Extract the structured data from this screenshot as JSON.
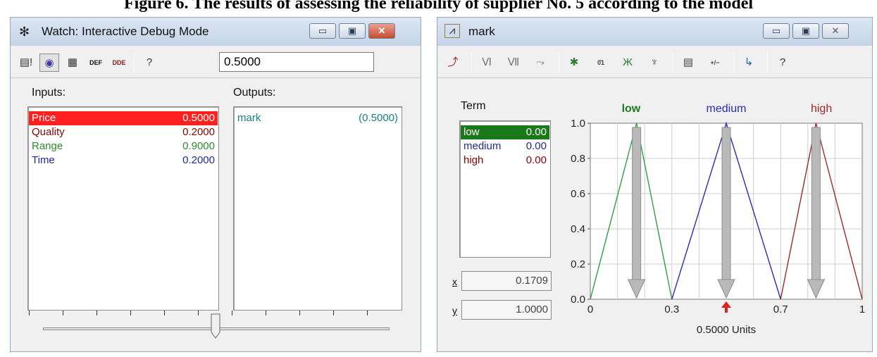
{
  "caption": "Figure 6. The results of assessing the reliability of supplier No. 5 according to the model",
  "watch": {
    "title": "Watch: Interactive Debug Mode",
    "title_icon": "bug-icon",
    "controls": {
      "minimize": "▭",
      "maximize": "▣",
      "close": "✕"
    },
    "toolbar": [
      {
        "id": "watch-mode",
        "glyph": "▤!",
        "icon": "watch-mode-icon",
        "color": "#333333"
      },
      {
        "id": "trace",
        "glyph": "◉",
        "icon": "trace-icon",
        "color": "#3a3aa8",
        "pressed": true
      },
      {
        "id": "clipboard",
        "glyph": "▦",
        "icon": "clipboard-icon",
        "color": "#333333"
      },
      {
        "id": "def",
        "glyph": "DEF",
        "icon": "def-icon",
        "color": "#111111"
      },
      {
        "id": "dde",
        "glyph": "DDE",
        "icon": "dde-icon",
        "color": "#8b1a1a"
      },
      {
        "id": "help",
        "glyph": "?",
        "icon": "help-icon",
        "color": "#333333"
      }
    ],
    "value": "0.5000",
    "inputs_label": "Inputs:",
    "outputs_label": "Outputs:",
    "inputs": [
      {
        "name": "Price",
        "value": "0.5000",
        "color": "#ffffff",
        "bg": "#ff2020",
        "selected": true
      },
      {
        "name": "Quality",
        "value": "0.2000",
        "color": "#8b0000",
        "bg": ""
      },
      {
        "name": "Range",
        "value": "0.9000",
        "color": "#2e8b2e",
        "bg": ""
      },
      {
        "name": "Time",
        "value": "0.2000",
        "color": "#1e2a9a",
        "bg": ""
      }
    ],
    "outputs": [
      {
        "name": "mark",
        "value": "(0.5000)",
        "color": "#1a8080"
      }
    ],
    "slider": {
      "value": 0.5
    }
  },
  "mark": {
    "title": "mark",
    "title_icon": "membership-function-icon",
    "controls": {
      "minimize": "▭",
      "maximize": "▣",
      "close": "✕"
    },
    "toolbar": [
      {
        "id": "t1",
        "glyph": "⤴",
        "icon": "arrow-up-right-icon",
        "color": "#b02020"
      },
      {
        "id": "t2",
        "glyph": "Ⅵ",
        "icon": "shape-1-icon",
        "color": "#777777"
      },
      {
        "id": "t3",
        "glyph": "Ⅶ",
        "icon": "shape-2-icon",
        "color": "#777777"
      },
      {
        "id": "t4",
        "glyph": "⤳",
        "icon": "shape-3-icon",
        "color": "#777777"
      },
      {
        "id": "t5",
        "glyph": "✱",
        "icon": "add-term-icon",
        "color": "#2e7d32"
      },
      {
        "id": "t6",
        "glyph": "0̄1",
        "icon": "normalize-icon",
        "color": "#444444"
      },
      {
        "id": "t7",
        "glyph": "Ж",
        "icon": "membership-icon",
        "color": "#2e7d32"
      },
      {
        "id": "t8",
        "glyph": "♆",
        "icon": "plant-icon",
        "color": "#444444"
      },
      {
        "id": "t9",
        "glyph": "▤",
        "icon": "document-icon",
        "color": "#444444"
      },
      {
        "id": "t10",
        "glyph": "+/−",
        "icon": "plus-minus-icon",
        "color": "#444444"
      },
      {
        "id": "t11",
        "glyph": "↳",
        "icon": "link-icon",
        "color": "#1e5fa8"
      },
      {
        "id": "t12",
        "glyph": "?",
        "icon": "help-icon",
        "color": "#333333"
      }
    ],
    "term_label": "Term",
    "terms": [
      {
        "name": "low",
        "value": "0.00",
        "color": "#ffffff",
        "bg": "#1a7a1a",
        "selected": true
      },
      {
        "name": "medium",
        "value": "0.00",
        "color": "#1e2a9a",
        "bg": ""
      },
      {
        "name": "high",
        "value": "0.00",
        "color": "#8b0000",
        "bg": ""
      }
    ],
    "x_label": "x",
    "y_label": "y",
    "x_value": "0.1709",
    "y_value": "1.0000",
    "units_label": "0.5000 Units"
  },
  "chart_data": {
    "type": "line",
    "title": "",
    "xlabel": "0.5000 Units",
    "ylabel": "",
    "xlim": [
      0,
      1
    ],
    "ylim": [
      0,
      1
    ],
    "x_ticks": [
      "0",
      "0.3",
      "0.7",
      "1"
    ],
    "y_ticks": [
      "0.0",
      "0.2",
      "0.4",
      "0.6",
      "0.8",
      "1.0"
    ],
    "grid": true,
    "legend": "top",
    "series": [
      {
        "name": "low",
        "color": "#2ea043",
        "label_color": "#1f7a1f",
        "x": [
          0,
          0.17,
          0.3
        ],
        "y": [
          0,
          1,
          0
        ],
        "arrow_x": 0.17
      },
      {
        "name": "medium",
        "color": "#2b2bb8",
        "label_color": "#2b2bb8",
        "x": [
          0.3,
          0.5,
          0.7
        ],
        "y": [
          0,
          1,
          0
        ],
        "arrow_x": 0.5
      },
      {
        "name": "high",
        "color": "#a02828",
        "label_color": "#a02828",
        "x": [
          0.7,
          0.83,
          1
        ],
        "y": [
          0,
          1,
          0
        ],
        "arrow_x": 0.83
      }
    ],
    "input_marker": 0.5
  }
}
